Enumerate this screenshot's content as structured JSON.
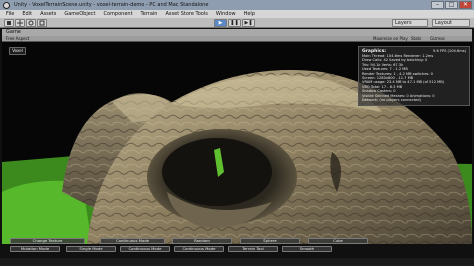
{
  "window": {
    "title": "Unity - VoxelTerrainScene.unity - voxel-terrain-demo - PC and Mac Standalone",
    "controls": [
      "–",
      "□",
      "✕"
    ]
  },
  "menu": [
    "File",
    "Edit",
    "Assets",
    "GameObject",
    "Component",
    "Terrain",
    "Asset Store Tools",
    "Window",
    "Help"
  ],
  "toolbar": {
    "play": "▶",
    "pause": "❚❚",
    "step": "▶❚",
    "layers": "Layers",
    "layout": "Layout"
  },
  "game_view": {
    "tab": "Game",
    "aspect": "Free Aspect",
    "maximize": "Maximize on Play",
    "gizmos": "Gizmos",
    "stats": "Stats",
    "label": "Voxel"
  },
  "statistics": {
    "title": "Graphics:",
    "fps": "9.6 FPS (104.6ms)",
    "rows": [
      "Main Thread: 104.6ms  Renderer: 1.2ms",
      "Draw Calls: 42   Saved by batching: 0",
      "Tris: 94.1k   Verts: 67.3k",
      "Used Textures: 7 - 1.2 MB",
      "Render Textures: 1 - 4.2 MB  switches: 0",
      "Screen: 1280x800 - 11.7 MB",
      "VRAM usage: 23.4 MB to 47.1 MB (of 512 MB)",
      "VBO Total: 17 - 6.3 MB",
      "Shadow Casters: 0",
      "Visible Skinned Meshes: 0   Animations: 0",
      "Network: (no players connected)"
    ]
  },
  "buttons_row1": [
    "Change Texture",
    "Continuous Mode",
    "Random",
    "Sphere",
    "Cube"
  ],
  "buttons_row2": [
    "Mutation Mode",
    "Single Mode",
    "Continuous Mode",
    "Continuous Mode",
    "Terrain Tool",
    "Smooth"
  ],
  "colors": {
    "sky": "#060606",
    "grass": "#3c8a1e",
    "rock_light": "#a89a78",
    "rock_dark": "#3b352a"
  }
}
